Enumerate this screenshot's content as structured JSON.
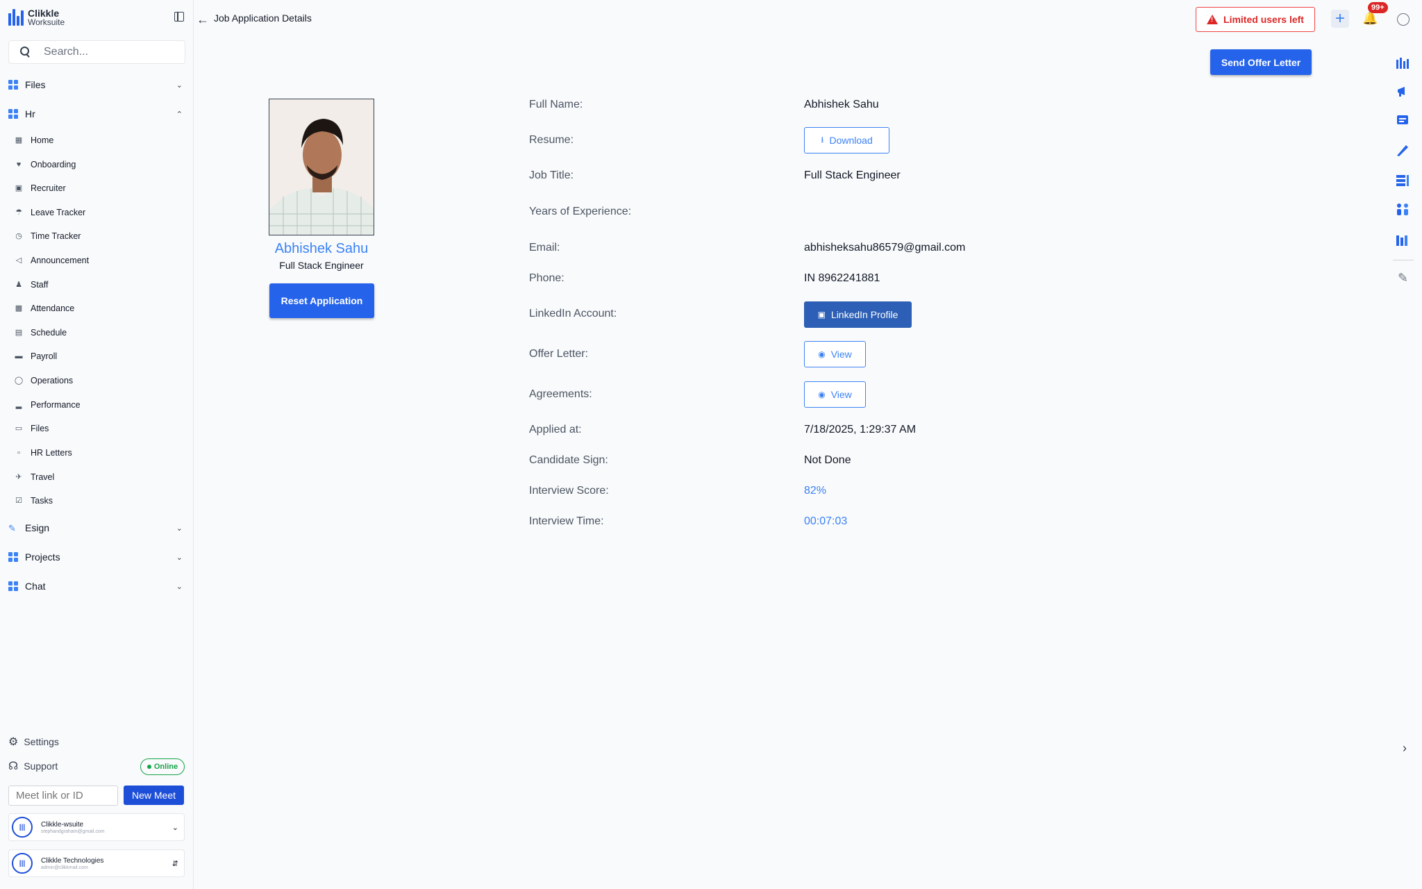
{
  "app": {
    "logo_line1": "Clikkle",
    "logo_line2": "Worksuite",
    "brand_color": "#2563eb"
  },
  "search": {
    "placeholder": "Search..."
  },
  "sidebar": {
    "sections": {
      "files": "Files",
      "hr": "Hr",
      "esign": "Esign",
      "projects": "Projects",
      "chat": "Chat"
    },
    "hr_items": [
      {
        "label": "Home",
        "icon": "grid-icon"
      },
      {
        "label": "Onboarding",
        "icon": "handshake-icon"
      },
      {
        "label": "Recruiter",
        "icon": "briefcase-icon"
      },
      {
        "label": "Leave Tracker",
        "icon": "beach-icon"
      },
      {
        "label": "Time Tracker",
        "icon": "alarm-icon"
      },
      {
        "label": "Announcement",
        "icon": "megaphone-icon"
      },
      {
        "label": "Staff",
        "icon": "people-icon"
      },
      {
        "label": "Attendance",
        "icon": "id-card-icon"
      },
      {
        "label": "Schedule",
        "icon": "calendar-icon"
      },
      {
        "label": "Payroll",
        "icon": "payment-icon"
      },
      {
        "label": "Operations",
        "icon": "cycle-icon"
      },
      {
        "label": "Performance",
        "icon": "bar-chart-icon"
      },
      {
        "label": "Files",
        "icon": "file-icon"
      },
      {
        "label": "HR Letters",
        "icon": "letter-icon"
      },
      {
        "label": "Travel",
        "icon": "plane-icon"
      },
      {
        "label": "Tasks",
        "icon": "task-icon"
      }
    ],
    "settings": "Settings",
    "support": "Support",
    "online": "Online",
    "meet_placeholder": "Meet link or ID",
    "new_meet": "New Meet",
    "accounts": [
      {
        "name": "Clikkle-wsuite",
        "email": "stephandgraham@gmail.com"
      },
      {
        "name": "Clikkle Technologies",
        "email": "admin@clikkmail.com"
      }
    ]
  },
  "header": {
    "title": "Job Application Details",
    "limited": "Limited users left",
    "badge": "99+"
  },
  "actions": {
    "send_offer": "Send Offer Letter",
    "reset": "Reset Application"
  },
  "candidate": {
    "name": "Abhishek Sahu",
    "role": "Full Stack Engineer"
  },
  "details": {
    "full_name_label": "Full Name:",
    "full_name": "Abhishek Sahu",
    "resume_label": "Resume:",
    "resume_btn": "Download",
    "job_title_label": "Job Title:",
    "job_title": "Full Stack Engineer",
    "experience_label": "Years of Experience:",
    "email_label": "Email:",
    "email": "abhisheksahu86579@gmail.com",
    "phone_label": "Phone:",
    "phone": "IN 8962241881",
    "linkedin_label": "LinkedIn Account:",
    "linkedin_btn": "LinkedIn Profile",
    "offer_label": "Offer Letter:",
    "offer_btn": "View",
    "agreements_label": "Agreements:",
    "agreements_btn": "View",
    "applied_label": "Applied at:",
    "applied": "7/18/2025, 1:29:37 AM",
    "sign_label": "Candidate Sign:",
    "sign": "Not Done",
    "score_label": "Interview Score:",
    "score": "82%",
    "time_label": "Interview Time:",
    "time": "00:07:03"
  }
}
